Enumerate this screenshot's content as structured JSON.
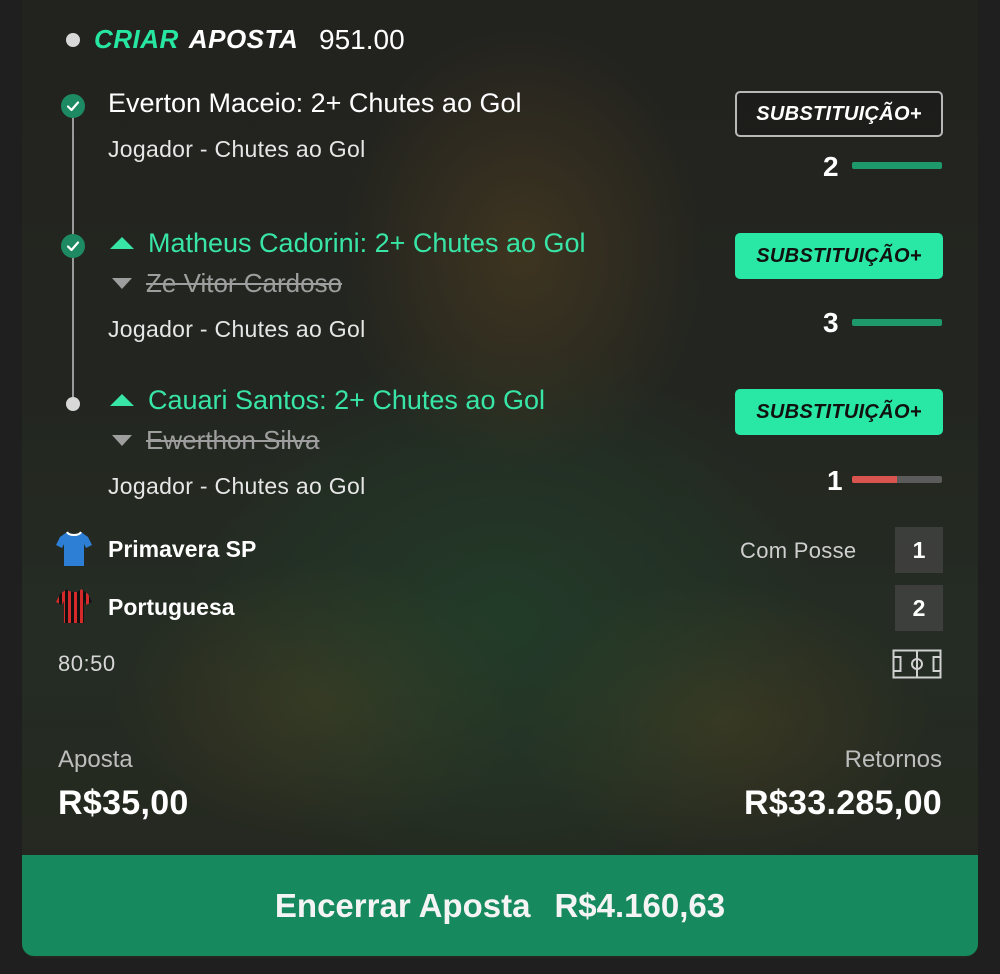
{
  "header": {
    "label_criar": "CRIAR",
    "label_aposta": "APOSTA",
    "odds": "951.00"
  },
  "selections": [
    {
      "title": "Everton Maceio: 2+ Chutes ao Gol",
      "replaced": "",
      "market": "Jogador - Chutes ao Gol",
      "button": "SUBSTITUIÇÃO+",
      "count": "2",
      "progress": 1.0,
      "progress_color": "#1e9a6a",
      "status": "won"
    },
    {
      "title": "Matheus Cadorini: 2+ Chutes ao Gol",
      "replaced": "Ze Vitor Cardoso",
      "market": "Jogador - Chutes ao Gol",
      "button": "SUBSTITUIÇÃO+",
      "count": "3",
      "progress": 1.0,
      "progress_color": "#1e9a6a",
      "status": "won"
    },
    {
      "title": "Cauari Santos: 2+ Chutes ao Gol",
      "replaced": "Ewerthon Silva",
      "market": "Jogador - Chutes ao Gol",
      "button": "SUBSTITUIÇÃO+",
      "count": "1",
      "progress": 0.5,
      "progress_color": "#d9534f",
      "status": "pending"
    }
  ],
  "match": {
    "home_team": "Primavera SP",
    "away_team": "Portuguesa",
    "possession_label": "Com Posse",
    "home_score": "1",
    "away_score": "2",
    "clock": "80:50"
  },
  "bet": {
    "stake_label": "Aposta",
    "stake": "R$35,00",
    "returns_label": "Retornos",
    "returns": "R$33.285,00"
  },
  "cashout": {
    "label": "Encerrar Aposta",
    "amount": "R$4.160,63"
  },
  "colors": {
    "accent": "#29e8a6",
    "cashout_bg": "#168a5e",
    "won_check": "#1e8a64",
    "progress_red": "#d9534f"
  }
}
